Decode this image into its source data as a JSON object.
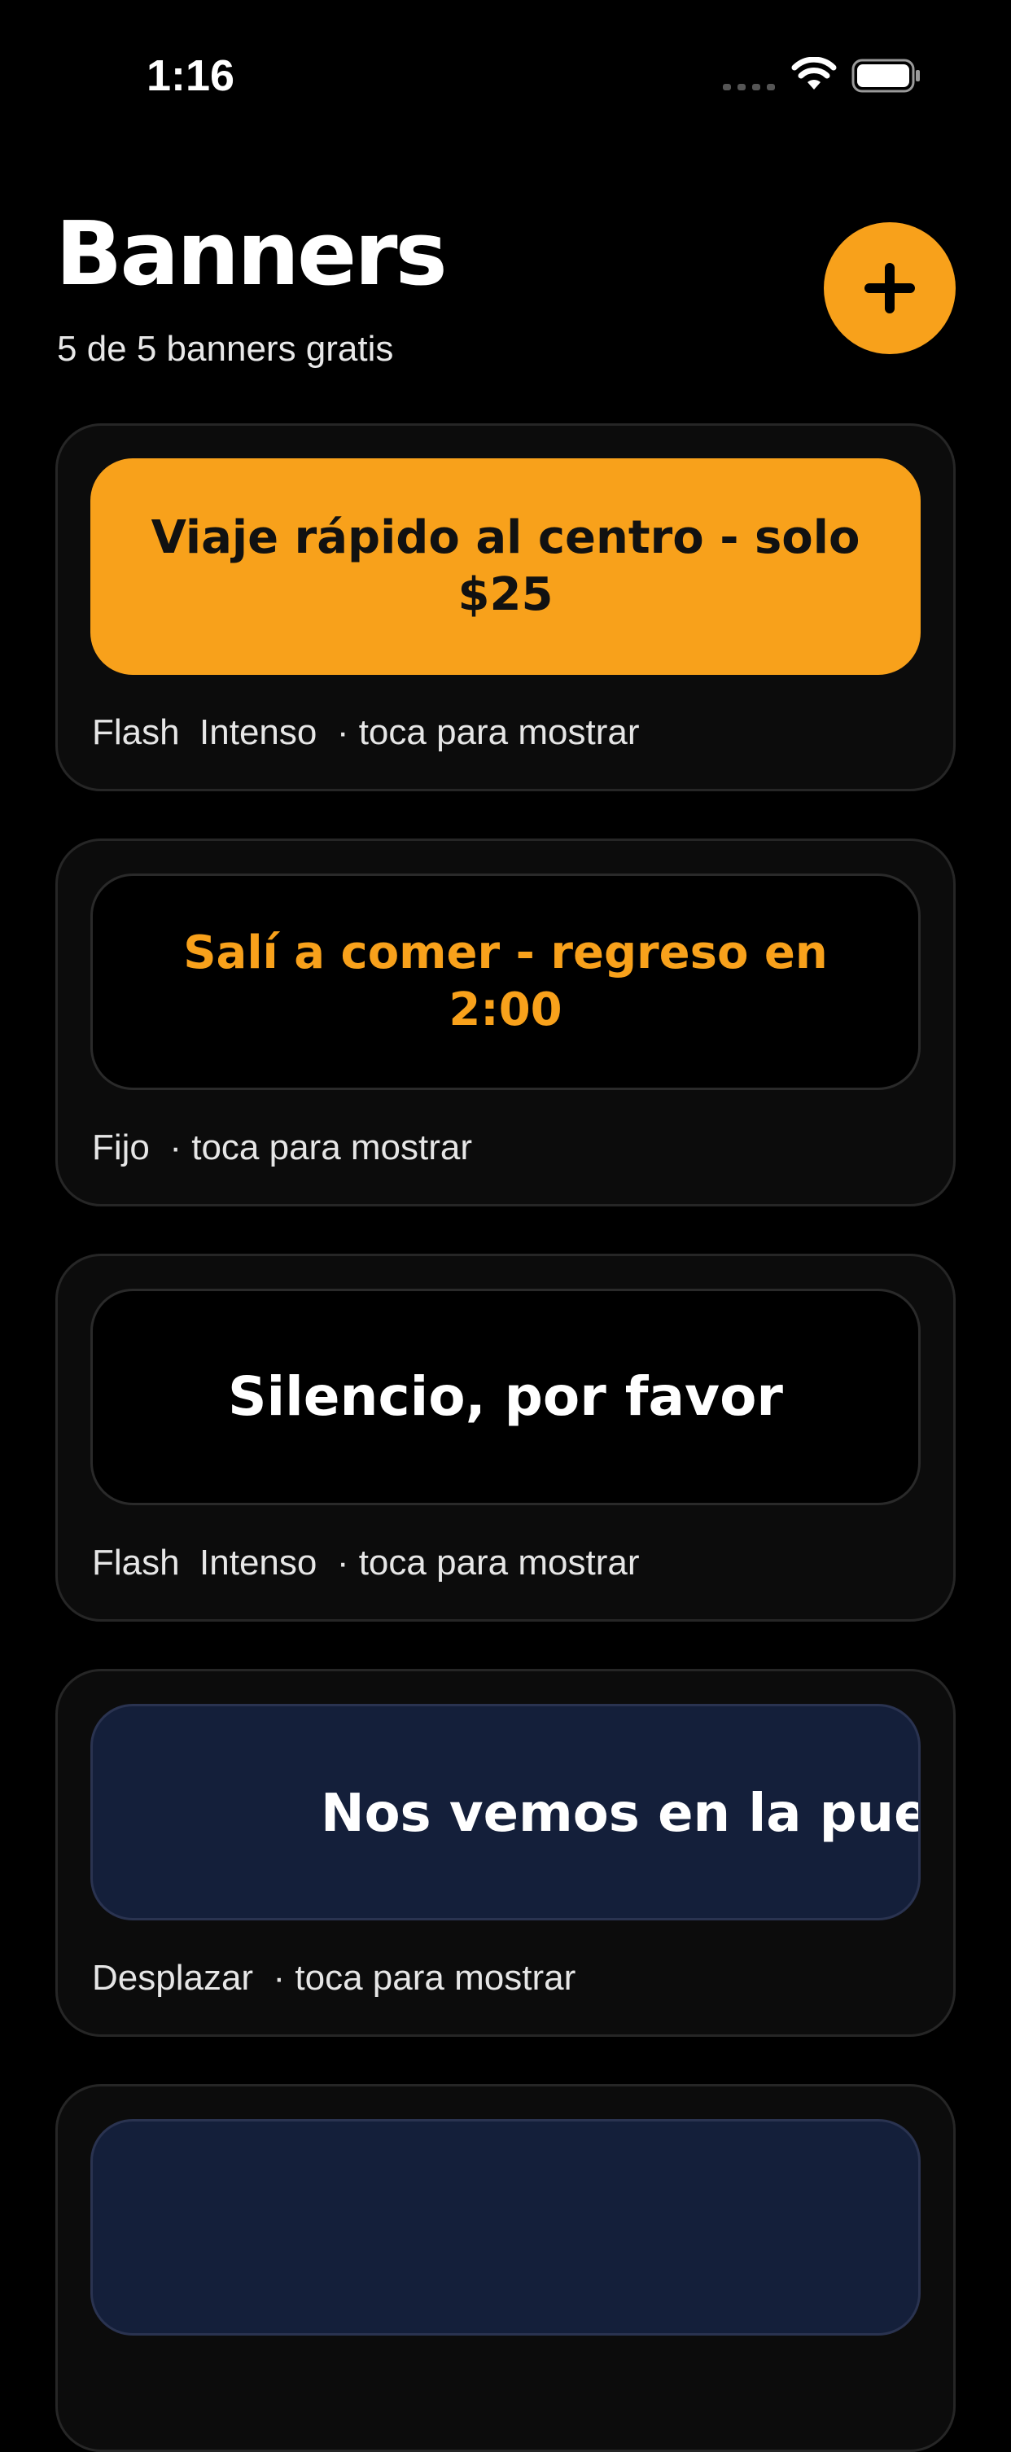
{
  "status_bar": {
    "time": "1:16",
    "icons": [
      "signal-icon",
      "wifi-icon",
      "battery-icon"
    ]
  },
  "header": {
    "title": "Banners",
    "subtitle": "5 de 5 banners gratis",
    "add_button_icon": "plus-icon"
  },
  "colors": {
    "accent": "#F8A11B",
    "background": "#000000",
    "card": "#0c0c0c",
    "navy": "#141F3A"
  },
  "banners": [
    {
      "text": "Viaje rápido al centro - solo $25",
      "meta": "Flash  Intenso  · toca para mostrar",
      "bg": "#F8A11B",
      "fg": "#111111"
    },
    {
      "text": "Salí a comer - regreso en 2:00",
      "meta": "Fijo  · toca para mostrar",
      "bg": "#000000",
      "fg": "#F8A11B"
    },
    {
      "text": "Silencio, por favor",
      "meta": "Flash  Intenso  · toca para mostrar",
      "bg": "#000000",
      "fg": "#ffffff"
    },
    {
      "text": "Nos vemos en la puer",
      "meta": "Desplazar  · toca para mostrar",
      "bg": "#141F3A",
      "fg": "#ffffff"
    },
    {
      "text": "",
      "meta": "",
      "bg": "#141F3A",
      "fg": "#ffffff"
    }
  ]
}
